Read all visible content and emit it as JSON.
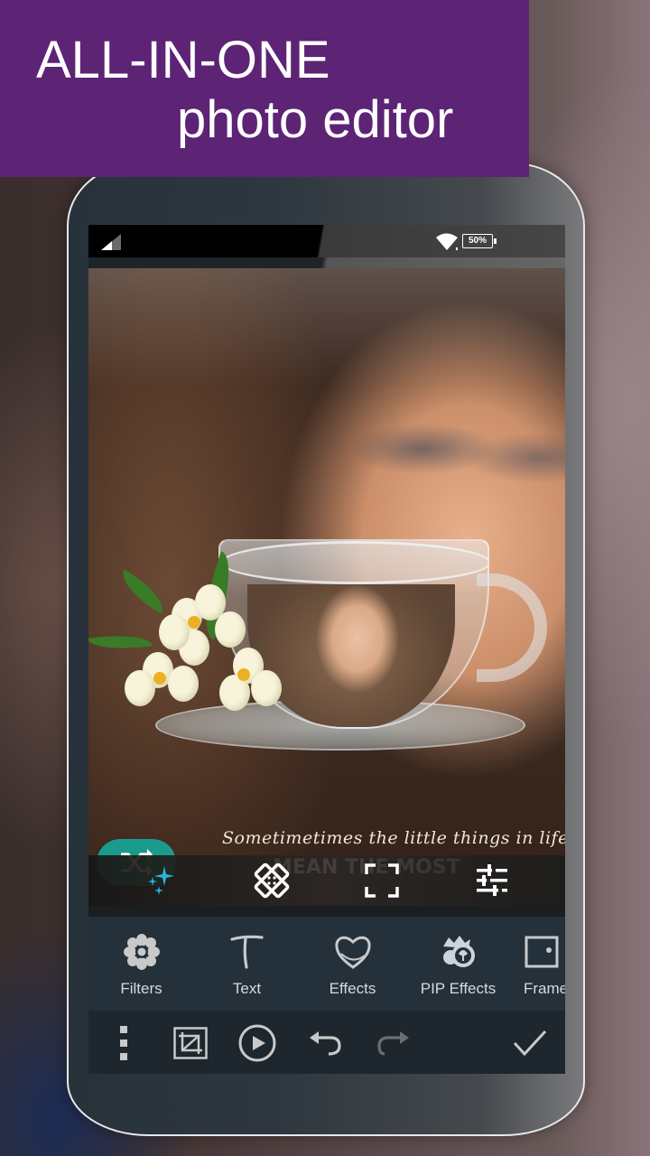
{
  "banner": {
    "line1": "ALL-IN-ONE",
    "line2": "photo editor",
    "background_color": "#5d2375"
  },
  "status_bar": {
    "signal_icon": "cell-signal-icon",
    "wifi_icon": "wifi-icon",
    "battery_level": "50%"
  },
  "canvas": {
    "quote_script": "Sometimetimes the little things in life",
    "quote_bold": "MEAN THE MOST",
    "shuffle_icon": "shuffle-icon",
    "shuffle_color": "#1f9a8a"
  },
  "edit_tools": [
    {
      "name": "magic",
      "icon": "sparkle-icon",
      "active": true,
      "color": "#29b6d8"
    },
    {
      "name": "heal",
      "icon": "bandage-icon",
      "active": false
    },
    {
      "name": "crop-fit",
      "icon": "fullscreen-frame-icon",
      "active": false
    },
    {
      "name": "adjust",
      "icon": "sliders-icon",
      "active": false
    }
  ],
  "features": [
    {
      "label": "Filters",
      "icon": "flower-filter-icon"
    },
    {
      "label": "Text",
      "icon": "text-t-icon"
    },
    {
      "label": "Effects",
      "icon": "heart-icon"
    },
    {
      "label": "PIP Effects",
      "icon": "pip-flower-icon"
    },
    {
      "label": "Frames",
      "icon": "frame-icon"
    }
  ],
  "actions": [
    {
      "name": "more",
      "icon": "more-vertical-icon"
    },
    {
      "name": "crop",
      "icon": "crop-icon"
    },
    {
      "name": "play",
      "icon": "play-circle-icon"
    },
    {
      "name": "undo",
      "icon": "undo-icon",
      "enabled": true
    },
    {
      "name": "redo",
      "icon": "redo-icon",
      "enabled": false
    },
    {
      "name": "confirm",
      "icon": "checkmark-icon"
    }
  ]
}
